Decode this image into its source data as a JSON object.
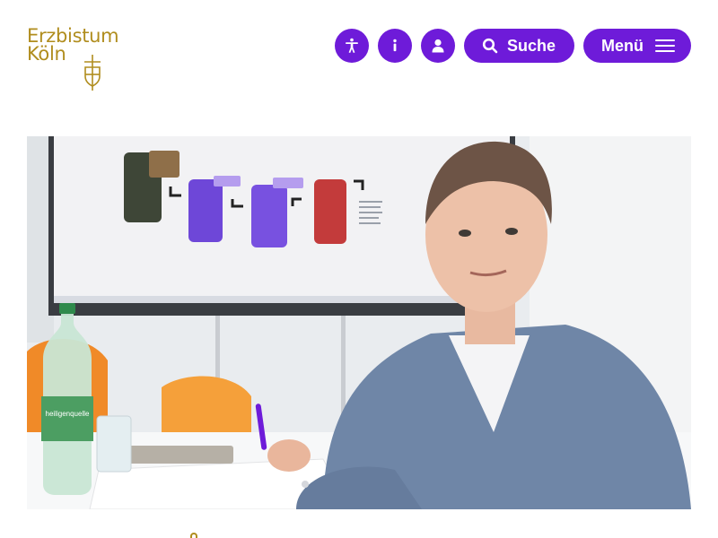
{
  "logo": {
    "line1": "Erzbistum",
    "line2": "Köln"
  },
  "nav": {
    "accessibility_icon": "accessibility-icon",
    "info_icon": "info-icon",
    "user_icon": "user-icon",
    "search_icon": "search-icon",
    "search_label": "Suche",
    "menu_label": "Menü",
    "menu_icon": "hamburger-icon"
  },
  "hero": {
    "bottle_label": "heiligenquelle"
  },
  "colors": {
    "brand_purple": "#6e1bd9",
    "logo_gold": "#b08d1e"
  }
}
